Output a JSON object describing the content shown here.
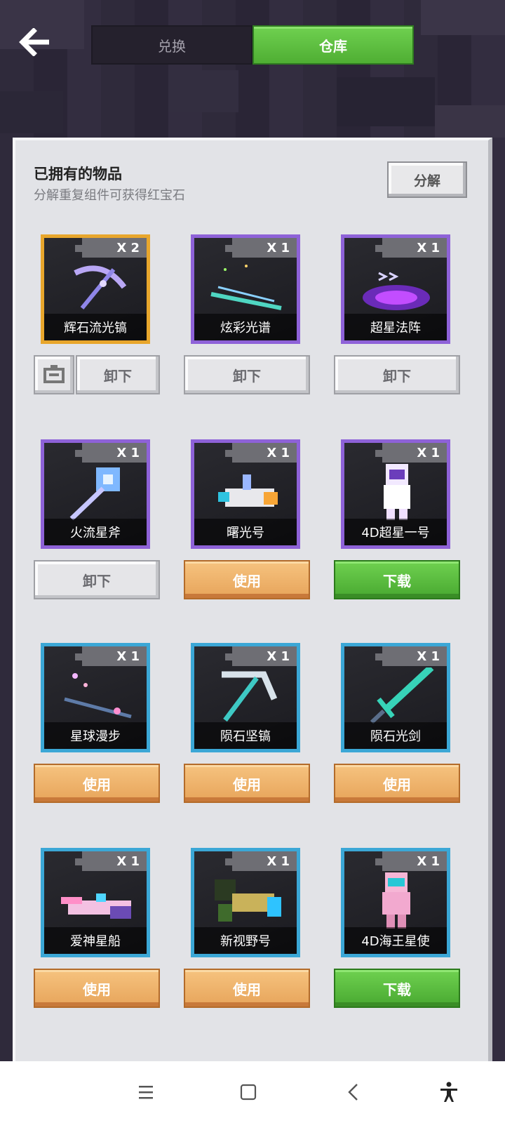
{
  "header": {
    "tabs": [
      {
        "label": "兑换",
        "active": false
      },
      {
        "label": "仓库",
        "active": true
      }
    ],
    "back_icon": "arrow-left-icon"
  },
  "panel": {
    "title": "已拥有的物品",
    "subtitle": "分解重复组件可获得红宝石",
    "decompose_label": "分解"
  },
  "items": [
    {
      "name": "辉石流光镐",
      "qty": "X 2",
      "rarity_color": "#e8a62c",
      "button": "卸下",
      "button_style": "gray",
      "extra_icon": "disassemble-icon"
    },
    {
      "name": "炫彩光谱",
      "qty": "X 1",
      "rarity_color": "#8e62d8",
      "button": "卸下",
      "button_style": "gray"
    },
    {
      "name": "超星法阵",
      "qty": "X 1",
      "rarity_color": "#8e62d8",
      "button": "卸下",
      "button_style": "gray"
    },
    {
      "name": "火流星斧",
      "qty": "X 1",
      "rarity_color": "#8e62d8",
      "button": "卸下",
      "button_style": "gray"
    },
    {
      "name": "曙光号",
      "qty": "X 1",
      "rarity_color": "#8e62d8",
      "button": "使用",
      "button_style": "orange"
    },
    {
      "name": "4D超星一号",
      "qty": "X 1",
      "rarity_color": "#8e62d8",
      "button": "下载",
      "button_style": "green"
    },
    {
      "name": "星球漫步",
      "qty": "X 1",
      "rarity_color": "#3ba7d6",
      "button": "使用",
      "button_style": "orange"
    },
    {
      "name": "陨石坚镐",
      "qty": "X 1",
      "rarity_color": "#3ba7d6",
      "button": "使用",
      "button_style": "orange"
    },
    {
      "name": "陨石光剑",
      "qty": "X 1",
      "rarity_color": "#3ba7d6",
      "button": "使用",
      "button_style": "orange"
    },
    {
      "name": "爱神星船",
      "qty": "X 1",
      "rarity_color": "#3ba7d6",
      "button": "使用",
      "button_style": "orange"
    },
    {
      "name": "新视野号",
      "qty": "X 1",
      "rarity_color": "#3ba7d6",
      "button": "使用",
      "button_style": "orange"
    },
    {
      "name": "4D海王星使",
      "qty": "X 1",
      "rarity_color": "#3ba7d6",
      "button": "下载",
      "button_style": "green"
    }
  ],
  "navbar": {
    "icons": [
      "menu-icon",
      "home-icon",
      "back-icon",
      "accessibility-icon"
    ]
  }
}
